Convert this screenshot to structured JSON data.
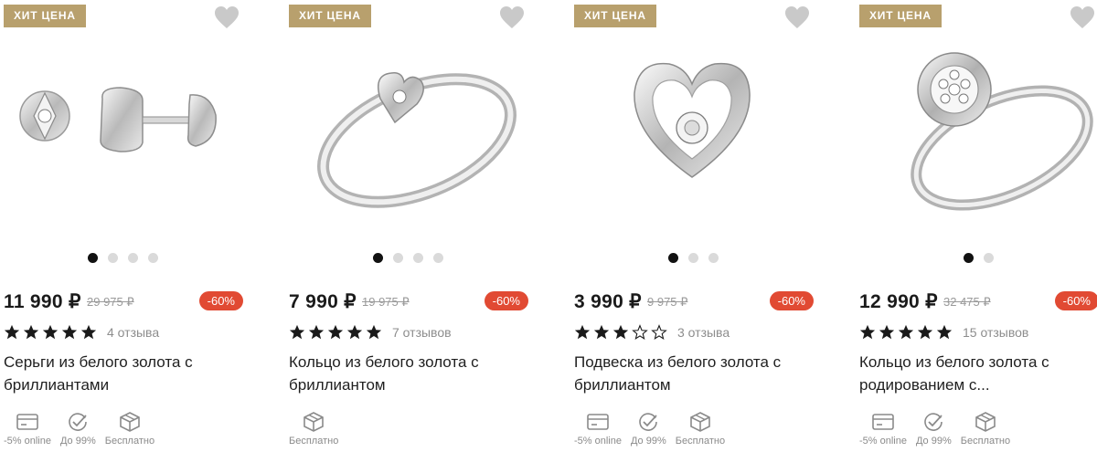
{
  "products": [
    {
      "badge": "ХИТ ЦЕНА",
      "price": "11 990 ₽",
      "old_price": "29 975 ₽",
      "discount": "-60%",
      "rating": 5,
      "reviews": "4 отзыва",
      "title": "Серьги из белого золота с бриллиантами",
      "image_icon": "stud-earrings-icon",
      "slides": 4,
      "active_slide": 0,
      "features": [
        {
          "icon": "card-icon",
          "label": "-5% online"
        },
        {
          "icon": "check-badge-icon",
          "label": "До 99%"
        },
        {
          "icon": "box-icon",
          "label": "Бесплатно"
        }
      ]
    },
    {
      "badge": "ХИТ ЦЕНА",
      "price": "7 990 ₽",
      "old_price": "19 975 ₽",
      "discount": "-60%",
      "rating": 5,
      "reviews": "7 отзывов",
      "title": "Кольцо из белого золота с бриллиантом",
      "image_icon": "heart-ring-icon",
      "slides": 4,
      "active_slide": 0,
      "features": [
        {
          "icon": "box-icon",
          "label": "Бесплатно"
        }
      ]
    },
    {
      "badge": "ХИТ ЦЕНА",
      "price": "3 990 ₽",
      "old_price": "9 975 ₽",
      "discount": "-60%",
      "rating": 3,
      "reviews": "3 отзыва",
      "title": "Подвеска из белого золота с бриллиантом",
      "image_icon": "heart-pendant-icon",
      "slides": 3,
      "active_slide": 0,
      "features": [
        {
          "icon": "card-icon",
          "label": "-5% online"
        },
        {
          "icon": "check-badge-icon",
          "label": "До 99%"
        },
        {
          "icon": "box-icon",
          "label": "Бесплатно"
        }
      ]
    },
    {
      "badge": "ХИТ ЦЕНА",
      "price": "12 990 ₽",
      "old_price": "32 475 ₽",
      "discount": "-60%",
      "rating": 5,
      "reviews": "15 отзывов",
      "title": "Кольцо из белого золота с родированием с...",
      "image_icon": "cluster-ring-icon",
      "slides": 2,
      "active_slide": 0,
      "features": [
        {
          "icon": "card-icon",
          "label": "-5% online"
        },
        {
          "icon": "check-badge-icon",
          "label": "До 99%"
        },
        {
          "icon": "box-icon",
          "label": "Бесплатно"
        }
      ]
    }
  ],
  "colors": {
    "badge": "#b8a06d",
    "discount": "#e14a33",
    "star": "#1a1a1a",
    "favorite": "#c9c9c9"
  }
}
